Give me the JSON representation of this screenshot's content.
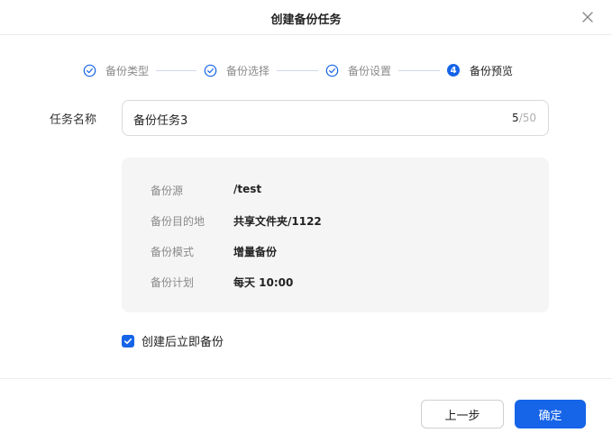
{
  "dialog": {
    "title": "创建备份任务",
    "close_icon": "close-icon"
  },
  "steps": [
    {
      "label": "备份类型",
      "state": "done",
      "icon": "check-circle-icon"
    },
    {
      "label": "备份选择",
      "state": "done",
      "icon": "check-circle-icon"
    },
    {
      "label": "备份设置",
      "state": "done",
      "icon": "check-circle-icon"
    },
    {
      "label": "备份预览",
      "state": "active",
      "number": "4"
    }
  ],
  "task_name": {
    "label": "任务名称",
    "value": "备份任务3",
    "count": "5",
    "max": "/50"
  },
  "summary": {
    "rows": [
      {
        "key": "备份源",
        "value": "/test"
      },
      {
        "key": "备份目的地",
        "value": "共享文件夹/1122"
      },
      {
        "key": "备份模式",
        "value": "增量备份"
      },
      {
        "key": "备份计划",
        "value": "每天 10:00"
      }
    ]
  },
  "backup_now": {
    "label": "创建后立即备份",
    "checked": true
  },
  "buttons": {
    "prev": "上一步",
    "confirm": "确定"
  },
  "colors": {
    "accent": "#1664e8"
  }
}
